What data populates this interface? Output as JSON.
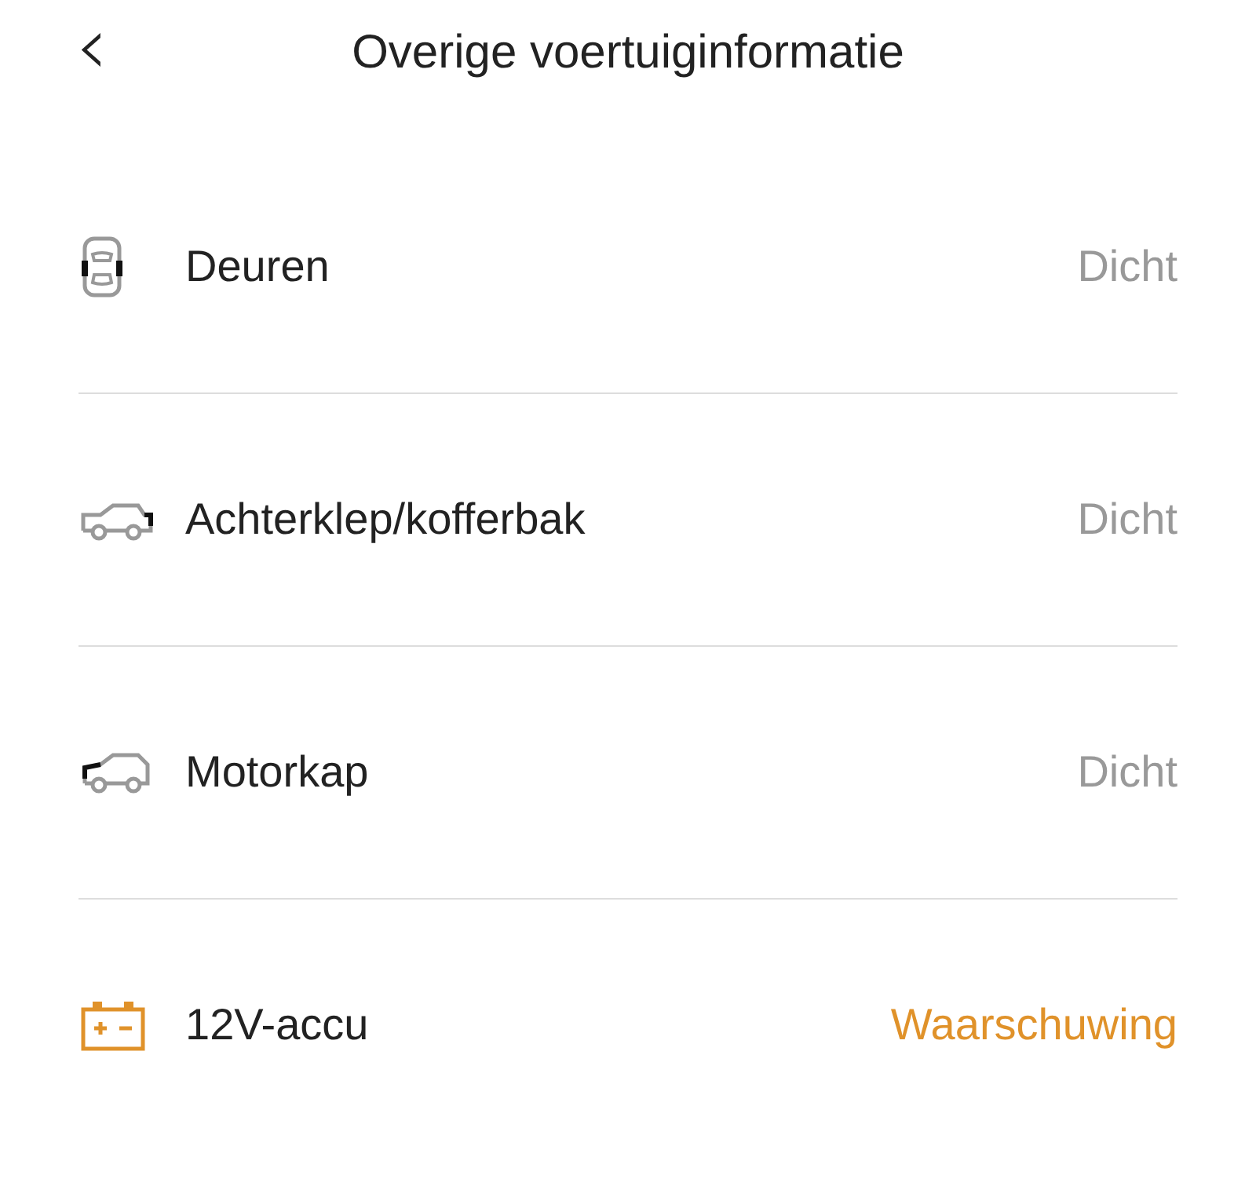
{
  "header": {
    "back_icon": "‹",
    "title": "Overige voertuiginformatie"
  },
  "items": [
    {
      "kind": "doors",
      "label": "Deuren",
      "status": "Dicht",
      "warning": false
    },
    {
      "kind": "tailgate",
      "label": "Achterklep/kofferbak",
      "status": "Dicht",
      "warning": false
    },
    {
      "kind": "hood",
      "label": "Motorkap",
      "status": "Dicht",
      "warning": false
    },
    {
      "kind": "battery",
      "label": "12V-accu",
      "status": "Waarschuwing",
      "warning": true
    }
  ]
}
